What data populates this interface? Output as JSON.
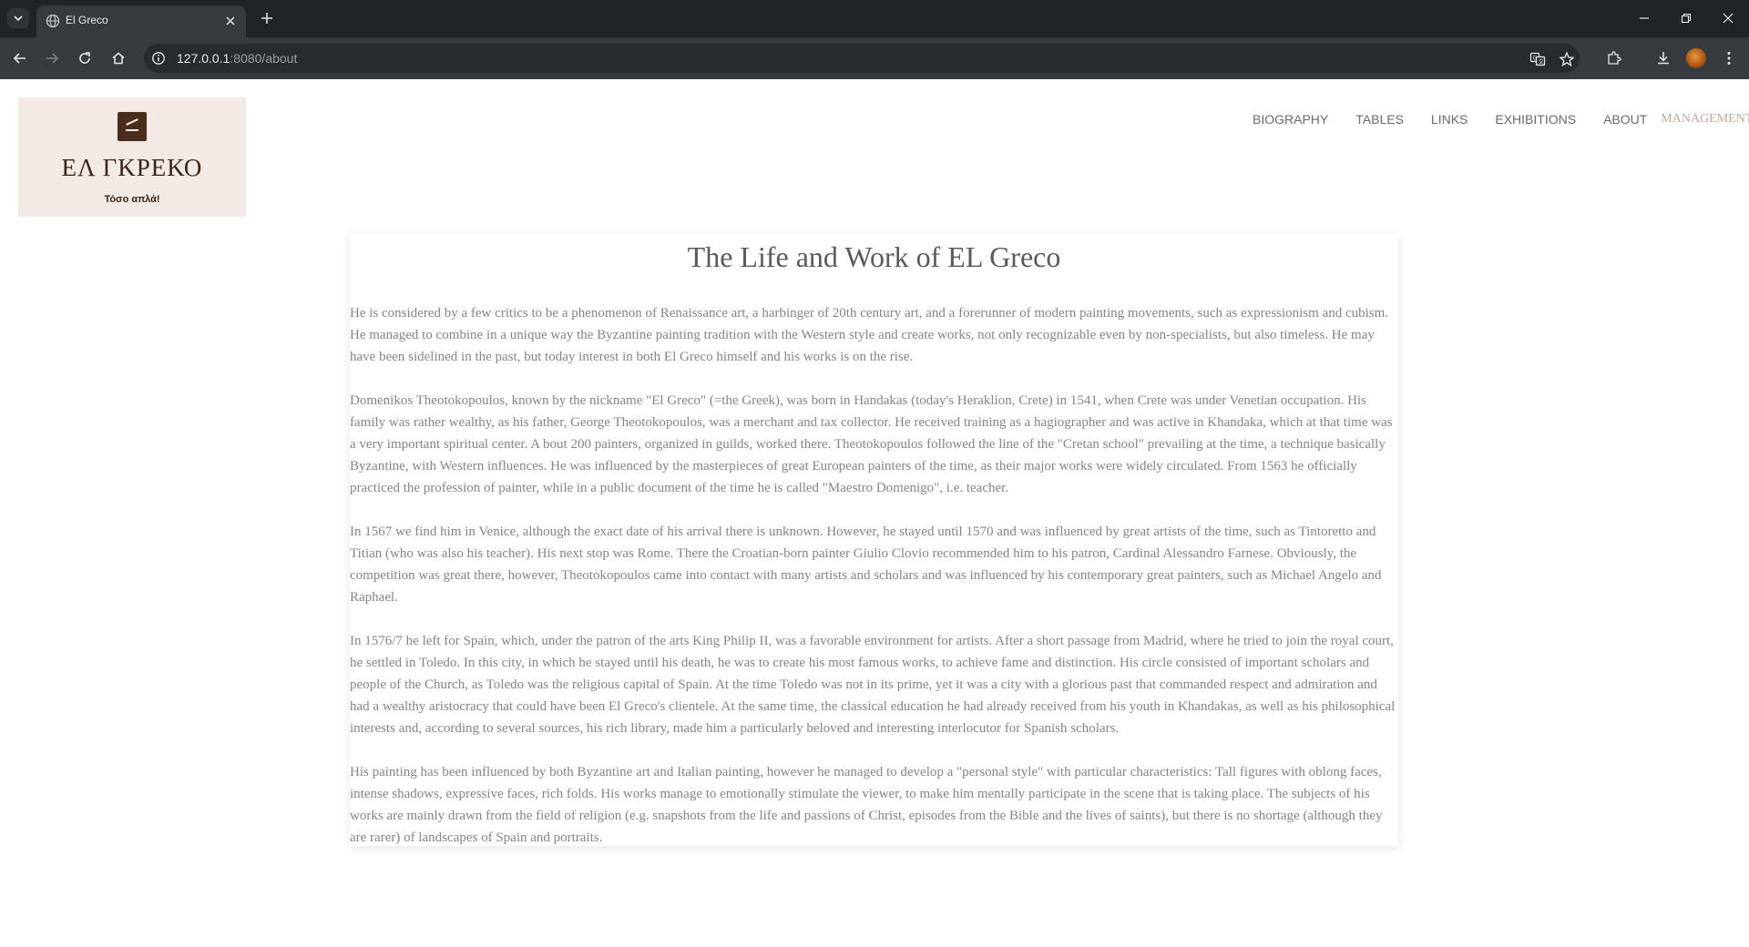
{
  "browser": {
    "tab_title": "El Greco",
    "url_host": "127.0.0.1",
    "url_path": ":8080/about"
  },
  "site": {
    "logo": {
      "name": "ΕΛ ΓΚΡΕΚΟ",
      "tagline": "Τόσο απλά!"
    },
    "nav": {
      "biography": "BIOGRAPHY",
      "tables": "TABLES",
      "links": "LINKS",
      "exhibitions": "EXHIBITIONS",
      "about": "ABOUT",
      "management": "MANAGEMENT"
    },
    "article": {
      "title": "The Life and Work of EL Greco",
      "paragraphs": [
        "He is considered by a few critics to be a phenomenon of Renaissance art, a harbinger of 20th century art, and a forerunner of modern painting movements, such as expressionism and cubism. He managed to combine in a unique way the Byzantine painting tradition with the Western style and create works, not only recognizable even by non-specialists, but also timeless. He may have been sidelined in the past, but today interest in both El Greco himself and his works is on the rise.",
        "Domenikos Theotokopoulos, known by the nickname \"El Greco\" (=the Greek), was born in Handakas (today's Heraklion, Crete) in 1541, when Crete was under Venetian occupation. His family was rather wealthy, as his father, George Theotokopoulos, was a merchant and tax collector. He received training as a hagiographer and was active in Khandaka, which at that time was a very important spiritual center. A bout 200 painters, organized in guilds, worked there. Theotokopoulos followed the line of the \"Cretan school\" prevailing at the time, a technique basically Byzantine, with Western influences. He was influenced by the masterpieces of great European painters of the time, as their major works were widely circulated. From 1563 he officially practiced the profession of painter, while in a public document of the time he is called \"Maestro Domenigo\", i.e. teacher.",
        "In 1567 we find him in Venice, although the exact date of his arrival there is unknown. However, he stayed until 1570 and was influenced by great artists of the time, such as Tintoretto and Titian (who was also his teacher). His next stop was Rome. There the Croatian-born painter Giulio Clovio recommended him to his patron, Cardinal Alessandro Farnese. Obviously, the competition was great there, however, Theotokopoulos came into contact with many artists and scholars and was influenced by his contemporary great painters, such as Michael Angelo and Raphael.",
        "In 1576/7 he left for Spain, which, under the patron of the arts King Philip II, was a favorable environment for artists. After a short passage from Madrid, where he tried to join the royal court, he settled in Toledo. In this city, in which he stayed until his death, he was to create his most famous works, to achieve fame and distinction. His circle consisted of important scholars and people of the Church, as Toledo was the religious capital of Spain. At the time Toledo was not in its prime, yet it was a city with a glorious past that commanded respect and admiration and had a wealthy aristocracy that could have been El Greco's clientele. At the same time, the classical education he had already received from his youth in Khandakas, as well as his philosophical interests and, according to several sources, his rich library, made him a particularly beloved and interesting interlocutor for Spanish scholars.",
        "His painting has been influenced by both Byzantine art and Italian painting, however he managed to develop a \"personal style\" with particular characteristics: Tall figures with oblong faces, intense shadows, expressive faces, rich folds. His works manage to emotionally stimulate the viewer, to make him mentally participate in the scene that is taking place. The subjects of his works are mainly drawn from the field of religion (e.g. snapshots from the life and passions of Christ, episodes from the Bible and the lives of saints), but there is no shortage (although they are rarer) of landscapes of Spain and portraits."
      ]
    }
  },
  "colors": {
    "chrome_dark": "#1f2426",
    "chrome_toolbar": "#353b3e",
    "logo_bg": "#f3e9e5",
    "logo_brown": "#3a2417",
    "nav_text": "#6b6b6b",
    "management_text": "#c4a59a",
    "body_text": "#858585"
  },
  "icons": {
    "tab_list": "chevron-down-icon",
    "favicon": "globe-icon",
    "tab_close": "close-icon",
    "new_tab": "plus-icon",
    "back": "arrow-left-icon",
    "forward": "arrow-right-icon",
    "reload": "reload-icon",
    "home": "home-icon",
    "site_info": "info-icon",
    "translate": "translate-icon",
    "bookmark": "star-icon",
    "extensions": "puzzle-icon",
    "downloads": "download-icon",
    "profile": "avatar",
    "menu": "kebab-menu-icon",
    "minimize": "minimize-icon",
    "restore": "restore-icon",
    "close_window": "close-icon"
  }
}
